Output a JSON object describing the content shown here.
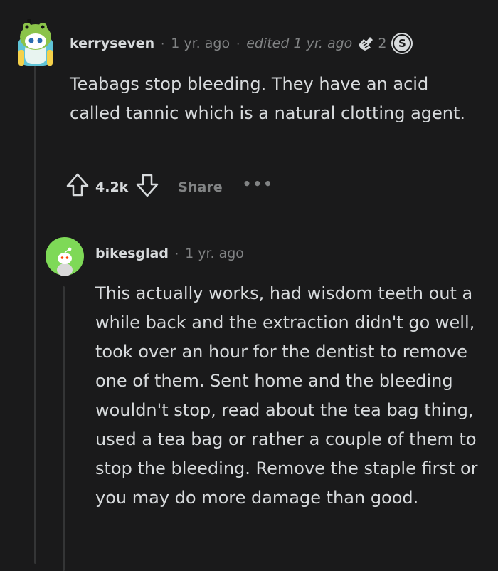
{
  "comment": {
    "username": "kerryseven",
    "time": "1 yr. ago",
    "edited": "edited 1 yr. ago",
    "award_icon": "award-icon",
    "award_count": "2",
    "badge_letter": "S",
    "body": "Teabags stop bleeding. They have an acid called tannic which is a natural clotting agent.",
    "vote_count": "4.2k",
    "share_label": "Share",
    "more_label": "•••"
  },
  "reply": {
    "username": "bikesglad",
    "time": "1 yr. ago",
    "body": "This actually works, had wisdom teeth out a while back and the extraction didn't go well, took over an hour for the dentist to remove one of them. Sent home and the bleeding wouldn't stop, read about the tea bag thing, used a tea bag or rather a couple of them to stop the bleeding. Remove the staple first or you may do more damage than good."
  },
  "colors": {
    "background": "#1a1a1b",
    "text": "#d7dadc",
    "muted": "#818384",
    "thread_line": "#343536",
    "avatar2_bg": "#7ed957"
  },
  "separator": "·"
}
